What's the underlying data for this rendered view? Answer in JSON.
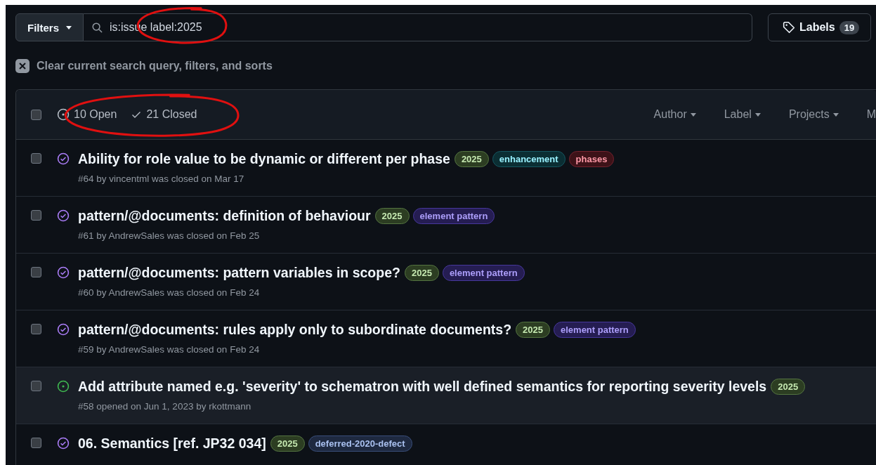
{
  "toolbar": {
    "filters_button": "Filters",
    "search": {
      "value": "is:issue label:2025",
      "circled": true
    },
    "labels_button": {
      "label": "Labels",
      "count": "19"
    }
  },
  "clear_link": "Clear current search query, filters, and sorts",
  "list_header": {
    "select_all_checked": false,
    "circled": true,
    "state_tabs": [
      {
        "kind": "open",
        "label": "10 Open",
        "selected": false
      },
      {
        "kind": "closed",
        "label": "21 Closed",
        "selected": false
      }
    ],
    "filters": [
      "Author",
      "Label",
      "Projects",
      "M"
    ]
  },
  "issues": [
    {
      "closed": true,
      "title": "Ability for role value to be dynamic or different per phase",
      "meta": "#64 by vincentml was closed on Mar 17",
      "highlighted": false,
      "checked": false,
      "labels": [
        {
          "name": "2025",
          "color": "#2c3d22"
        },
        {
          "name": "enhancement",
          "color": "#0b2e33"
        },
        {
          "name": "phases",
          "color": "#3d1218"
        }
      ]
    },
    {
      "closed": true,
      "title": "pattern/@documents: definition of behaviour",
      "meta": "#61 by AndrewSales was closed on Feb 25",
      "highlighted": false,
      "checked": false,
      "labels": [
        {
          "name": "2025",
          "color": "#2c3d22"
        },
        {
          "name": "element pattern",
          "color": "#251d52"
        }
      ]
    },
    {
      "closed": true,
      "title": "pattern/@documents: pattern variables in scope?",
      "meta": "#60 by AndrewSales was closed on Feb 24",
      "highlighted": false,
      "checked": false,
      "labels": [
        {
          "name": "2025",
          "color": "#2c3d22"
        },
        {
          "name": "element pattern",
          "color": "#251d52"
        }
      ]
    },
    {
      "closed": true,
      "title": "pattern/@documents: rules apply only to subordinate documents?",
      "meta": "#59 by AndrewSales was closed on Feb 24",
      "highlighted": false,
      "checked": false,
      "labels": [
        {
          "name": "2025",
          "color": "#2c3d22"
        },
        {
          "name": "element pattern",
          "color": "#251d52"
        }
      ]
    },
    {
      "closed": false,
      "title": "Add attribute named e.g. 'severity' to schematron with well defined semantics for reporting severity levels",
      "meta": "#58 opened on Jun 1, 2023 by rkottmann",
      "highlighted": true,
      "checked": false,
      "labels": [
        {
          "name": "2025",
          "color": "#2c3d22"
        }
      ]
    },
    {
      "closed": true,
      "title": "06. Semantics [ref. JP32 034]",
      "highlighted": false,
      "checked": false,
      "labels": [
        {
          "name": "2025",
          "color": "#2c3d22"
        },
        {
          "name": "deferred-2020-defect",
          "color": "#1e2940"
        }
      ]
    }
  ]
}
